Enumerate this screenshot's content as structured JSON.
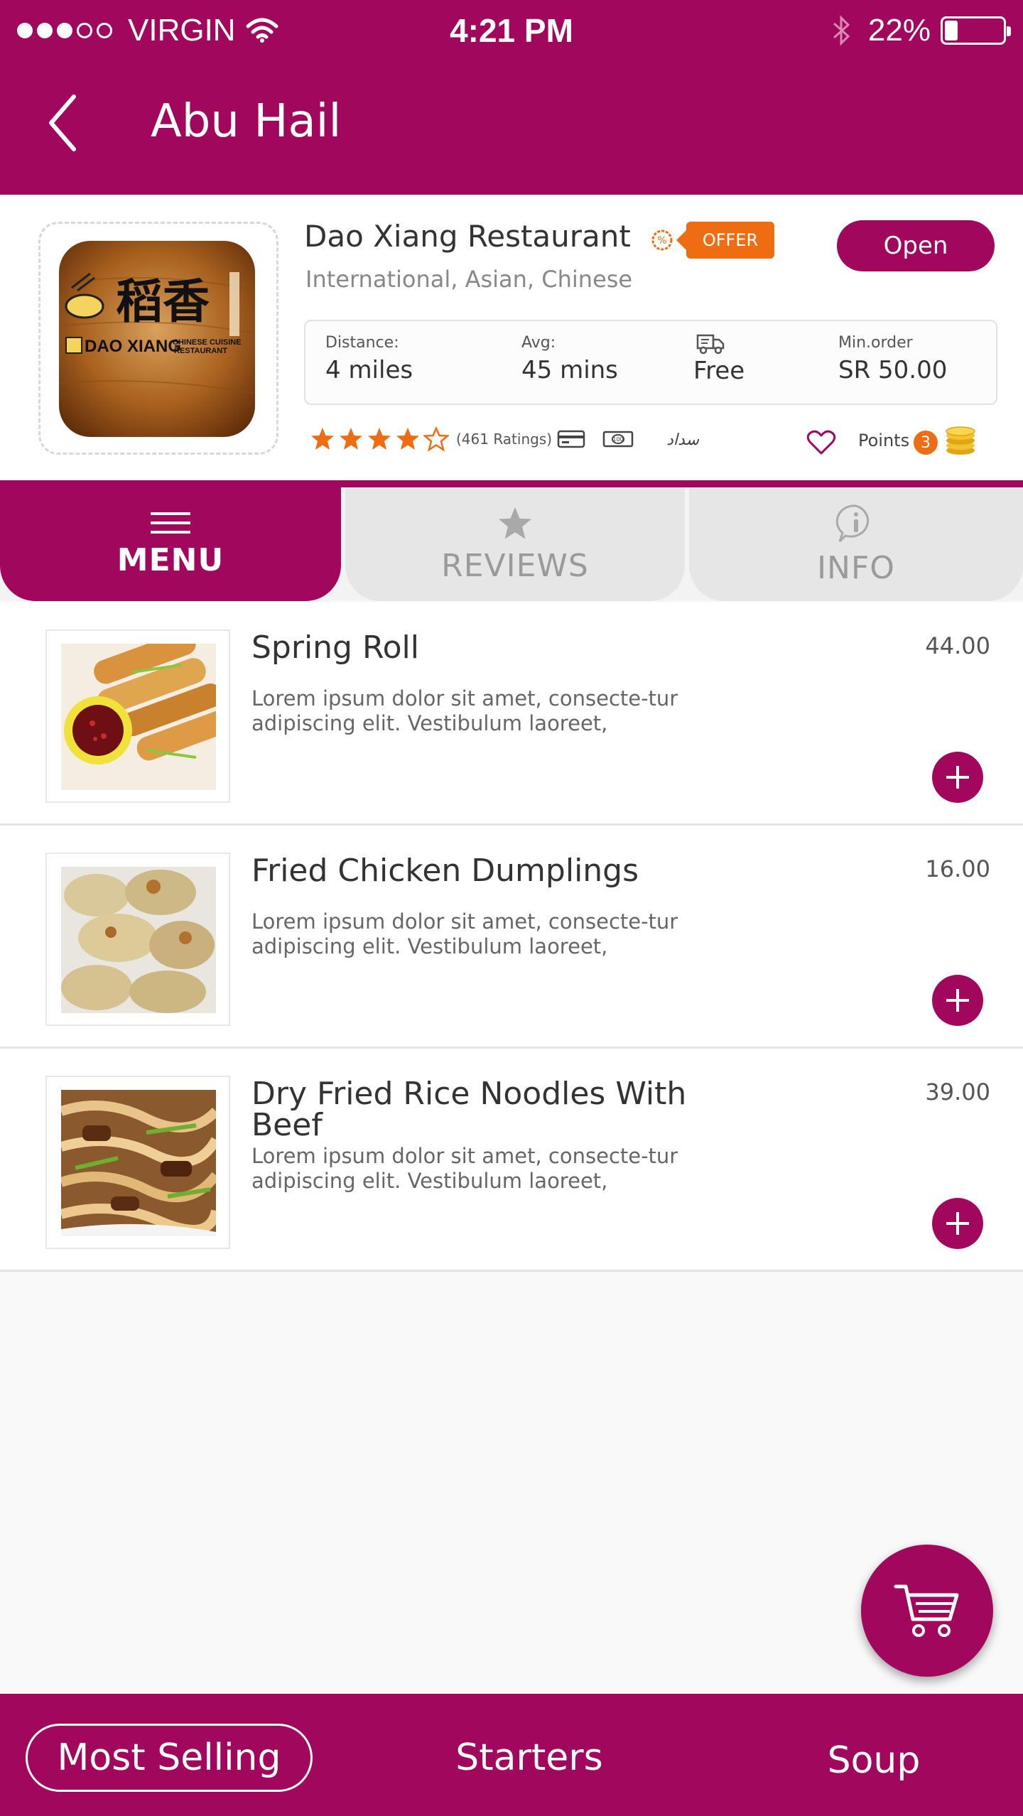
{
  "status_bar": {
    "carrier": "VIRGIN",
    "time": "4:21 PM",
    "battery": "22%",
    "signal_dots_filled": 3,
    "signal_dots_total": 5,
    "battery_level": 0.22
  },
  "header": {
    "title": "Abu Hail",
    "back_icon": "chevron-left-icon"
  },
  "restaurant": {
    "name": "Dao Xiang Restaurant",
    "offer_badge": "OFFER",
    "status_button": "Open",
    "cuisine": "International, Asian, Chinese",
    "logo": {
      "chinese_text": "稻香",
      "brand_text": "DAO XIANG",
      "brand_sub_1": "CHINESE CUISINE",
      "brand_sub_2": "RESTAURANT"
    },
    "stats": {
      "distance_label": "Distance:",
      "distance_value": "4 miles",
      "avg_label": "Avg:",
      "avg_value": "45 mins",
      "delivery_value": "Free",
      "min_order_label": "Min.order",
      "min_order_value": "SR 50.00"
    },
    "rating": {
      "stars_filled": 4,
      "stars_total": 5,
      "count_text": "(461 Ratings)"
    },
    "payment_methods": [
      "card-icon",
      "cash-icon",
      "sadad-icon"
    ],
    "sadad_text": "سداد",
    "points_label": "Points",
    "points_value": "3"
  },
  "tabs": [
    {
      "label": "MENU",
      "icon": "hamburger-icon",
      "active": true
    },
    {
      "label": "REVIEWS",
      "icon": "star-icon",
      "active": false
    },
    {
      "label": "INFO",
      "icon": "info-icon",
      "active": false
    }
  ],
  "menu_items": [
    {
      "name": "Spring Roll",
      "description": "Lorem ipsum dolor sit amet, consecte-tur adipiscing elit. Vestibulum laoreet,",
      "price": "44.00"
    },
    {
      "name": "Fried Chicken Dumplings",
      "description": "Lorem ipsum dolor sit amet, consecte-tur adipiscing elit. Vestibulum laoreet,",
      "price": "16.00"
    },
    {
      "name": "Dry Fried Rice Noodles With Beef",
      "description": "Lorem ipsum dolor sit amet, consecte-tur adipiscing elit. Vestibulum laoreet,",
      "price": "39.00"
    }
  ],
  "categories": [
    {
      "label": "Most Selling",
      "active": true
    },
    {
      "label": "Starters",
      "active": false
    },
    {
      "label": "Soup",
      "active": false
    }
  ],
  "colors": {
    "brand": "#a1075c",
    "accent_orange": "#ee6d12",
    "background": "#f9f9f9"
  }
}
